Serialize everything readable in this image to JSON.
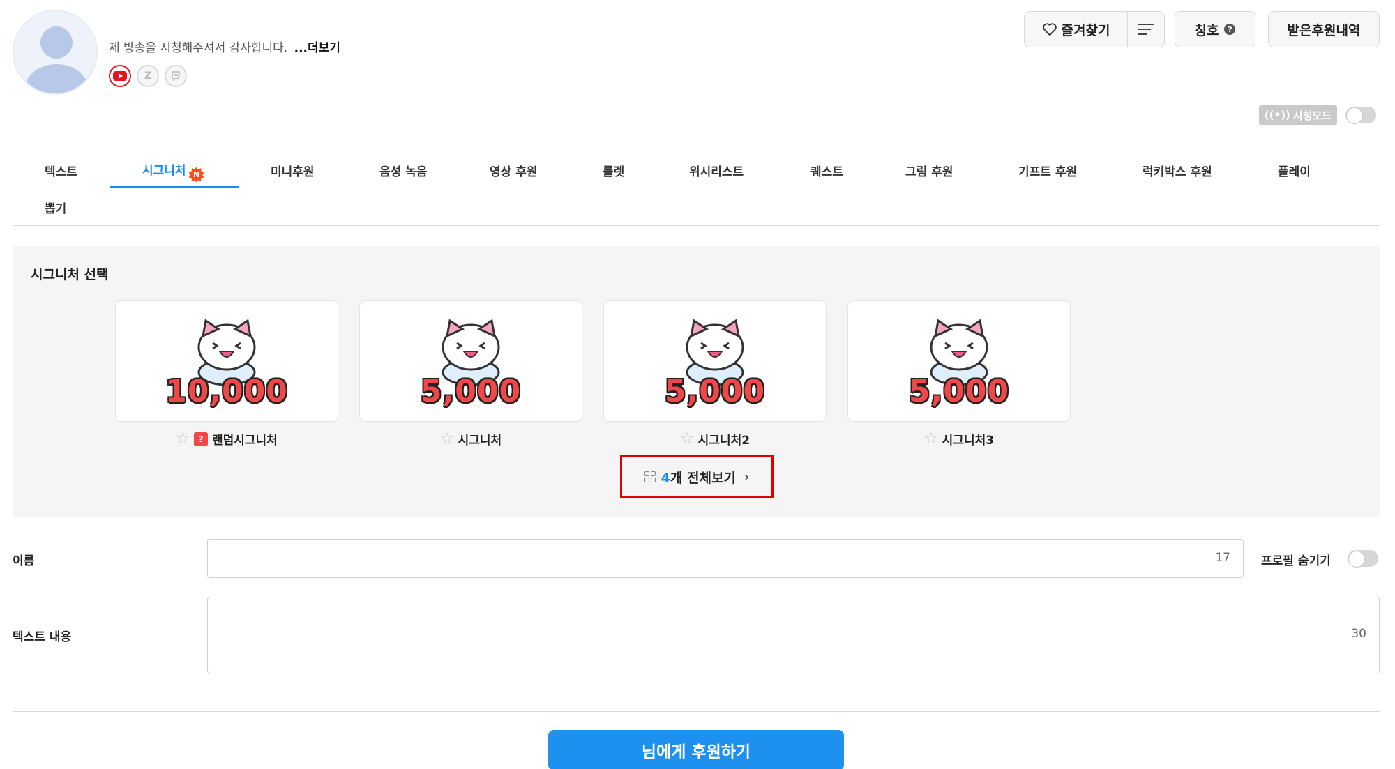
{
  "profile": {
    "greeting": "제 방송을 시청해주셔서 감사합니다.",
    "more_link": "...더보기",
    "socials": [
      "youtube-icon",
      "zz-icon",
      "twitch-icon"
    ]
  },
  "header": {
    "favorite_label": "즐겨찾기",
    "title_label": "칭호",
    "history_label": "받은후원내역",
    "watch_mode_label": "시청모드",
    "watch_mode_icon": "((•))"
  },
  "tabs": [
    {
      "label": "텍스트"
    },
    {
      "label": "시그니처",
      "badge": "N"
    },
    {
      "label": "미니후원"
    },
    {
      "label": "음성 녹음"
    },
    {
      "label": "영상 후원"
    },
    {
      "label": "룰렛"
    },
    {
      "label": "위시리스트"
    },
    {
      "label": "퀘스트"
    },
    {
      "label": "그림 후원"
    },
    {
      "label": "기프트 후원"
    },
    {
      "label": "럭키박스 후원"
    },
    {
      "label": "플레이"
    },
    {
      "label": "뽑기"
    }
  ],
  "signature": {
    "title": "시그니처 선택",
    "cards": [
      {
        "amount": "10,000",
        "label": "랜덤시그니처",
        "random_icon": "?"
      },
      {
        "amount": "5,000",
        "label": "시그니처"
      },
      {
        "amount": "5,000",
        "label": "시그니처2"
      },
      {
        "amount": "5,000",
        "label": "시그니처3"
      }
    ],
    "view_all": {
      "count": "4",
      "text": "개 전체보기",
      "chevron": "›"
    }
  },
  "form": {
    "name_label": "이름",
    "name_counter": "17",
    "profile_hide_label": "프로필 숨기기",
    "text_label": "텍스트 내용",
    "text_counter": "30"
  },
  "submit_label": "님에게 후원하기",
  "colors": {
    "accent": "#1a8bf0",
    "submit": "#1e90ef",
    "highlight": "#e00000",
    "amount": "#f04848"
  }
}
